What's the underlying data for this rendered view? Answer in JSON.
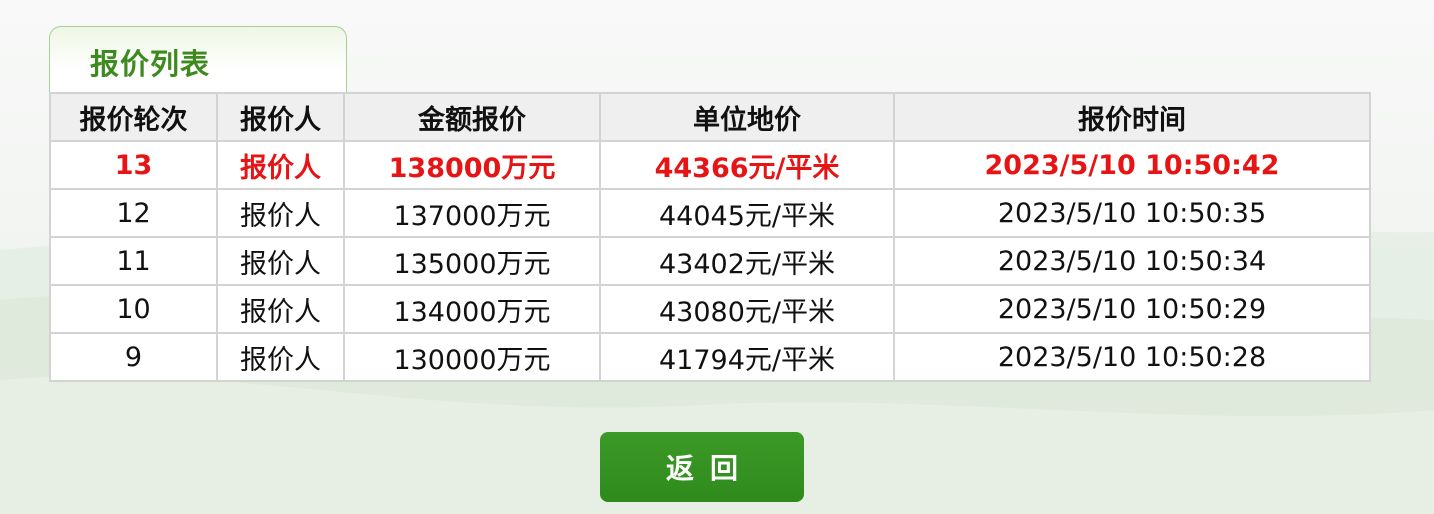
{
  "panel": {
    "title": "报价列表"
  },
  "table": {
    "headers": [
      "报价轮次",
      "报价人",
      "金额报价",
      "单位地价",
      "报价时间"
    ],
    "rows": [
      {
        "round": "13",
        "bidder": "报价人",
        "amount": "138000万元",
        "unit_price": "44366元/平米",
        "time": "2023/5/10 10:50:42",
        "highlight": true
      },
      {
        "round": "12",
        "bidder": "报价人",
        "amount": "137000万元",
        "unit_price": "44045元/平米",
        "time": "2023/5/10 10:50:35",
        "highlight": false
      },
      {
        "round": "11",
        "bidder": "报价人",
        "amount": "135000万元",
        "unit_price": "43402元/平米",
        "time": "2023/5/10 10:50:34",
        "highlight": false
      },
      {
        "round": "10",
        "bidder": "报价人",
        "amount": "134000万元",
        "unit_price": "43080元/平米",
        "time": "2023/5/10 10:50:29",
        "highlight": false
      },
      {
        "round": "9",
        "bidder": "报价人",
        "amount": "130000万元",
        "unit_price": "41794元/平米",
        "time": "2023/5/10 10:50:28",
        "highlight": false
      }
    ]
  },
  "actions": {
    "back_label": "返回"
  },
  "colors": {
    "accent_green": "#3e8a1f",
    "highlight_red": "#e61414",
    "button_green": "#2f8a1c"
  }
}
